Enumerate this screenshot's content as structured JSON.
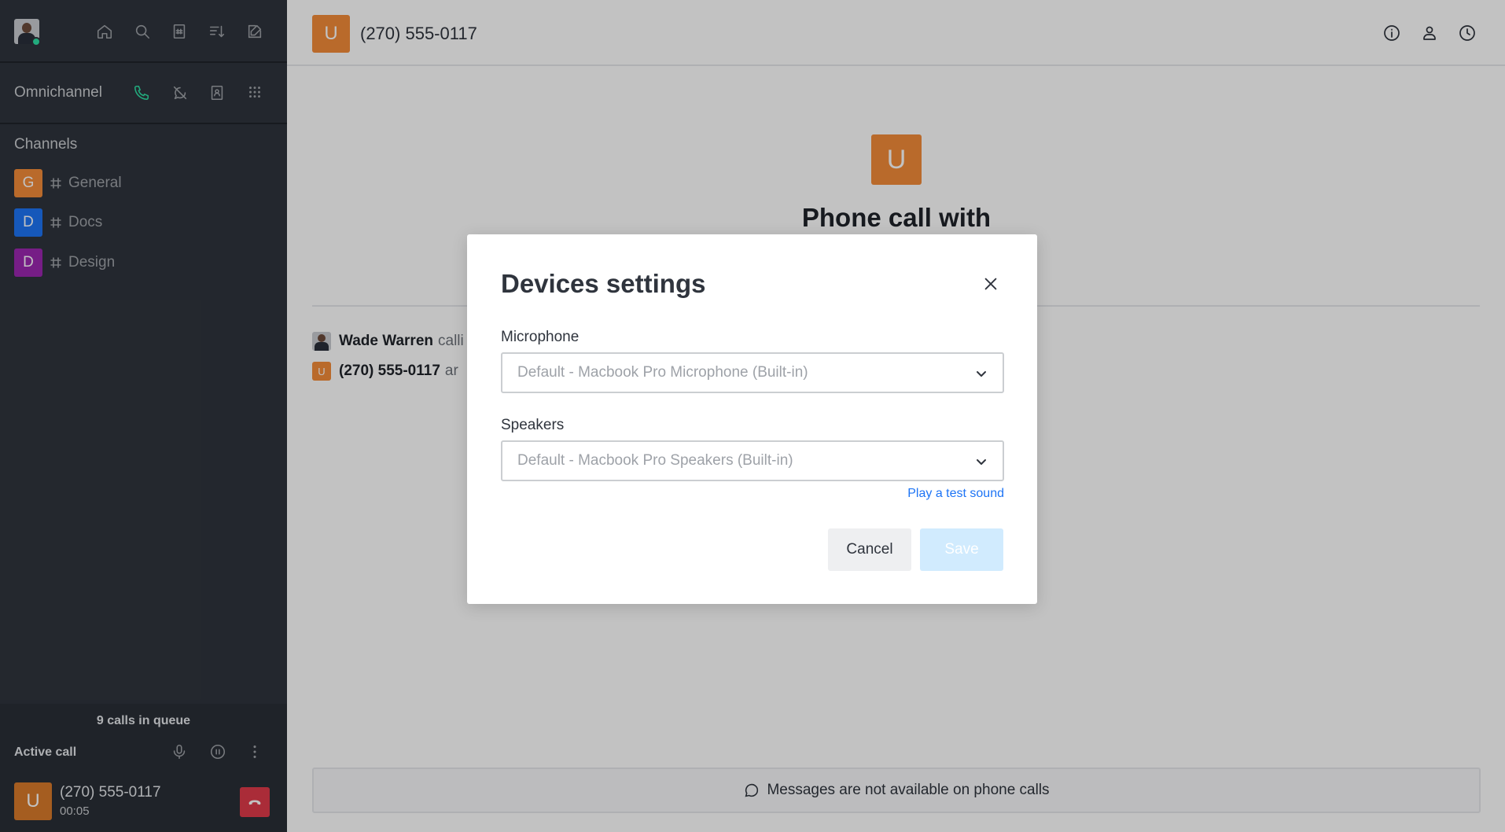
{
  "sidebar": {
    "omnichannel_label": "Omnichannel",
    "channels_title": "Channels",
    "channels": [
      {
        "initial": "G",
        "name": "General",
        "color": "#f38c39"
      },
      {
        "initial": "D",
        "name": "Docs",
        "color": "#1d74f5"
      },
      {
        "initial": "D",
        "name": "Design",
        "color": "#9c27b0"
      }
    ],
    "queue_text": "9 calls in queue",
    "active_call_label": "Active call",
    "caller": {
      "initial": "U",
      "number": "(270) 555-0117",
      "duration": "00:05"
    }
  },
  "header": {
    "avatar_initial": "U",
    "title": "(270) 555-0117"
  },
  "call": {
    "avatar_initial": "U",
    "title": "Phone call with"
  },
  "messages": [
    {
      "name": "Wade Warren",
      "text": "calli"
    },
    {
      "avatar_initial": "U",
      "name": "(270) 555-0117",
      "text": "ar"
    }
  ],
  "composer": {
    "text": "Messages are not available on phone calls"
  },
  "modal": {
    "title": "Devices settings",
    "microphone_label": "Microphone",
    "microphone_value": "Default - Macbook Pro Microphone (Built-in)",
    "speakers_label": "Speakers",
    "speakers_value": "Default - Macbook Pro Speakers (Built-in)",
    "test_sound": "Play a test sound",
    "cancel": "Cancel",
    "save": "Save"
  },
  "colors": {
    "accent_green": "#2de0a5",
    "hangup_red": "#e03a4a",
    "link_blue": "#1d74f5"
  }
}
